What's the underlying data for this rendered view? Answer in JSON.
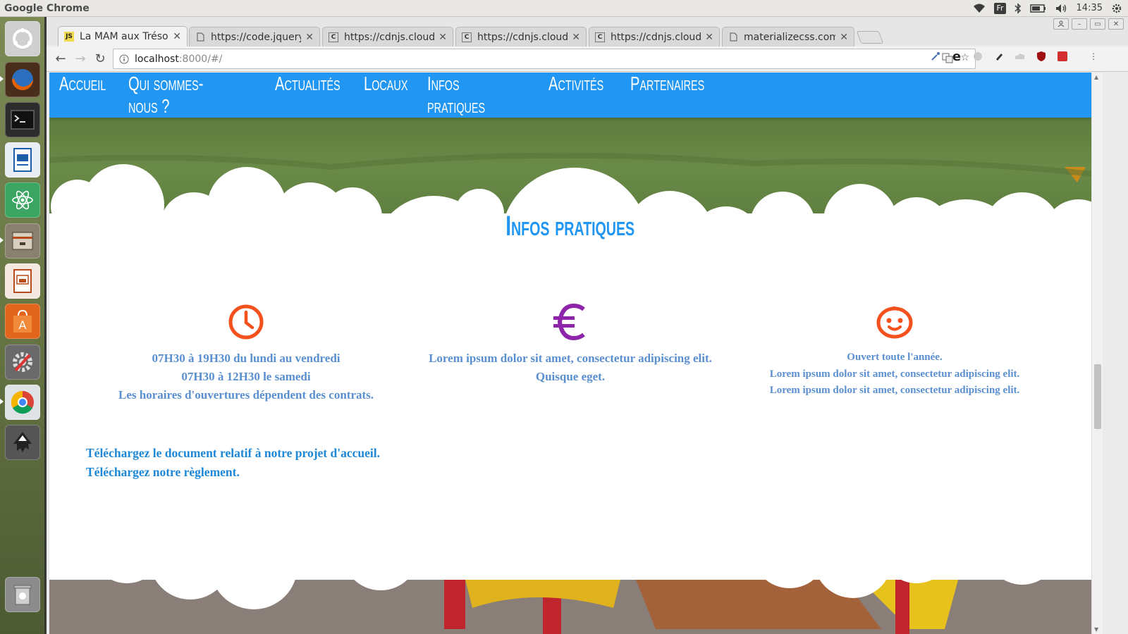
{
  "os_panel": {
    "app_name": "Google Chrome",
    "keyboard_layout": "Fr",
    "time": "14:35"
  },
  "launcher": {
    "items": [
      {
        "name": "ubuntu-home",
        "color": "#c9c9c9"
      },
      {
        "name": "firefox",
        "color": "#e66000"
      },
      {
        "name": "terminal",
        "color": "#2c2c2c"
      },
      {
        "name": "writer",
        "color": "#1c5ea8"
      },
      {
        "name": "atom",
        "color": "#3aa661"
      },
      {
        "name": "files",
        "color": "#8a8070"
      },
      {
        "name": "impress",
        "color": "#b84a1c"
      },
      {
        "name": "software-center",
        "color": "#e0651a"
      },
      {
        "name": "settings",
        "color": "#7a7a7a"
      },
      {
        "name": "chrome",
        "color": "#dfe3e6"
      },
      {
        "name": "inkscape",
        "color": "#444444"
      },
      {
        "name": "trash",
        "color": "#9a9a9a"
      }
    ]
  },
  "browser": {
    "tabs": [
      {
        "label": "La MAM aux Trésor",
        "favicon": "JS",
        "active": true
      },
      {
        "label": "https://code.jquery",
        "favicon": "doc",
        "active": false
      },
      {
        "label": "https://cdnjs.cloud",
        "favicon": "C",
        "active": false
      },
      {
        "label": "https://cdnjs.cloud",
        "favicon": "C",
        "active": false
      },
      {
        "label": "https://cdnjs.cloud",
        "favicon": "C",
        "active": false
      },
      {
        "label": "materializecss.com",
        "favicon": "doc",
        "active": false
      }
    ],
    "address": {
      "host": "localhost",
      "path": ":8000/#/"
    }
  },
  "site": {
    "nav": [
      "Accueil",
      "Qui sommes-nous ?",
      "Actualités",
      "Locaux",
      "Infos pratiques",
      "Activités",
      "Partenaires"
    ],
    "section_title": "Infos pratiques",
    "columns": [
      {
        "icon": "clock-icon",
        "icon_color": "#f4511e",
        "lines": [
          "07H30 à 19H30 du lundi au vendredi",
          "07H30 à 12H30 le samedi",
          "Les horaires d'ouvertures dépendent des contrats."
        ]
      },
      {
        "icon": "euro-icon",
        "icon_color": "#8e24aa",
        "lines": [
          "Lorem ipsum dolor sit amet, consectetur adipiscing elit.",
          "Quisque eget."
        ]
      },
      {
        "icon": "baby-face-icon",
        "icon_color": "#f4511e",
        "lines": [
          "Ouvert toute l'année.",
          "Lorem ipsum dolor sit amet, consectetur adipiscing elit.",
          "Lorem ipsum dolor sit amet, consectetur adipiscing elit."
        ]
      }
    ],
    "downloads": [
      "Téléchargez le document relatif à notre projet d'accueil.",
      "Téléchargez notre règlement."
    ],
    "colors": {
      "nav_bg": "#2196f3",
      "title": "#2196f3",
      "body_text": "#5a8fd0",
      "link": "#1e88d8"
    }
  }
}
